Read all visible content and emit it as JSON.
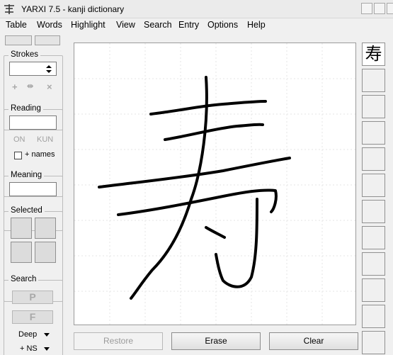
{
  "window": {
    "title": "YARXI 7.5   -   kanji dictionary"
  },
  "menu": [
    "Table",
    "Words",
    "Highlight",
    "View",
    "Search",
    "Entry",
    "Options",
    "Help"
  ],
  "strokes": {
    "label": "Strokes",
    "value": ""
  },
  "reading": {
    "label": "Reading",
    "value": "",
    "on_label": "ON",
    "kun_label": "KUN",
    "names_label": "+ names",
    "names_checked": false
  },
  "meaning": {
    "label": "Meaning",
    "value": ""
  },
  "selected": {
    "label": "Selected"
  },
  "search": {
    "label": "Search",
    "p_label": "P",
    "f_label": "F",
    "depth_label": "Deep",
    "ns_label": "+ NS"
  },
  "buttons": {
    "restore": "Restore",
    "erase": "Erase",
    "clear": "Clear"
  },
  "candidates": [
    "寿",
    "",
    "",
    "",
    "",
    "",
    "",
    "",
    "",
    "",
    "",
    ""
  ],
  "icons": {
    "add": "plus-icon",
    "range": "range-icon",
    "remove": "x-icon",
    "app": "yarxi-app-icon"
  }
}
